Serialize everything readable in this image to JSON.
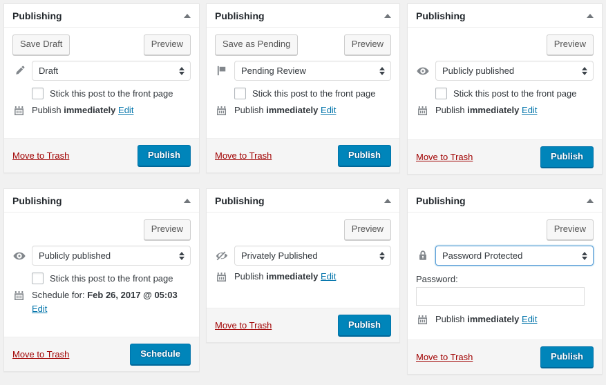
{
  "panels": [
    {
      "title": "Publishing",
      "collapse_icon": "triangle-up-icon",
      "save_label": "Save Draft",
      "preview_label": "Preview",
      "status_icon": "pencil-icon",
      "status_value": "Draft",
      "select_focused": false,
      "sticky_label": "Stick this post to the front page",
      "sticky_checked": false,
      "date_icon": "calendar-icon",
      "date_prefix": "Publish ",
      "date_value": "immediately",
      "date_edit_label": "Edit",
      "date_wrap": false,
      "password_label": null,
      "password_value": "",
      "trash_label": "Move to Trash",
      "primary_label": "Publish"
    },
    {
      "title": "Publishing",
      "collapse_icon": "triangle-up-icon",
      "save_label": "Save as Pending",
      "preview_label": "Preview",
      "status_icon": "flag-icon",
      "status_value": "Pending Review",
      "select_focused": false,
      "sticky_label": "Stick this post to the front page",
      "sticky_checked": false,
      "date_icon": "calendar-icon",
      "date_prefix": "Publish ",
      "date_value": "immediately",
      "date_edit_label": "Edit",
      "date_wrap": false,
      "password_label": null,
      "password_value": "",
      "trash_label": "Move to Trash",
      "primary_label": "Publish"
    },
    {
      "title": "Publishing",
      "collapse_icon": "triangle-up-icon",
      "save_label": null,
      "preview_label": "Preview",
      "status_icon": "eye-icon",
      "status_value": "Publicly published",
      "select_focused": false,
      "sticky_label": "Stick this post to the front page",
      "sticky_checked": false,
      "date_icon": "calendar-icon",
      "date_prefix": "Publish ",
      "date_value": "immediately",
      "date_edit_label": "Edit",
      "date_wrap": false,
      "password_label": null,
      "password_value": "",
      "trash_label": "Move to Trash",
      "primary_label": "Publish"
    },
    {
      "title": "Publishing",
      "collapse_icon": "triangle-up-icon",
      "save_label": null,
      "preview_label": "Preview",
      "status_icon": "eye-icon",
      "status_value": "Publicly published",
      "select_focused": false,
      "sticky_label": "Stick this post to the front page",
      "sticky_checked": false,
      "date_icon": "calendar-icon",
      "date_prefix": "Schedule for: ",
      "date_value": "Feb 26, 2017 @ 05:03",
      "date_edit_label": "Edit",
      "date_wrap": true,
      "password_label": null,
      "password_value": "",
      "trash_label": "Move to Trash",
      "primary_label": "Schedule"
    },
    {
      "title": "Publishing",
      "collapse_icon": "triangle-up-icon",
      "save_label": null,
      "preview_label": "Preview",
      "status_icon": "eye-slash-icon",
      "status_value": "Privately Published",
      "select_focused": false,
      "sticky_label": null,
      "sticky_checked": false,
      "date_icon": "calendar-icon",
      "date_prefix": "Publish ",
      "date_value": "immediately",
      "date_edit_label": "Edit",
      "date_wrap": false,
      "password_label": null,
      "password_value": "",
      "trash_label": "Move to Trash",
      "primary_label": "Publish"
    },
    {
      "title": "Publishing",
      "collapse_icon": "triangle-up-icon",
      "save_label": null,
      "preview_label": "Preview",
      "status_icon": "lock-icon",
      "status_value": "Password Protected",
      "select_focused": true,
      "sticky_label": null,
      "sticky_checked": false,
      "date_icon": "calendar-icon",
      "date_prefix": "Publish ",
      "date_value": "immediately",
      "date_edit_label": "Edit",
      "date_wrap": false,
      "password_label": "Password:",
      "password_value": "",
      "trash_label": "Move to Trash",
      "primary_label": "Publish"
    }
  ],
  "colors": {
    "page_background": "#f1f1f1",
    "panel_background": "#ffffff",
    "panel_border": "#e5e5e5",
    "footer_background": "#f5f5f5",
    "primary_button": "#0085ba",
    "link": "#0073aa",
    "trash_link": "#a00000",
    "focus_border": "#5b9dd9",
    "icon": "#82878c"
  }
}
